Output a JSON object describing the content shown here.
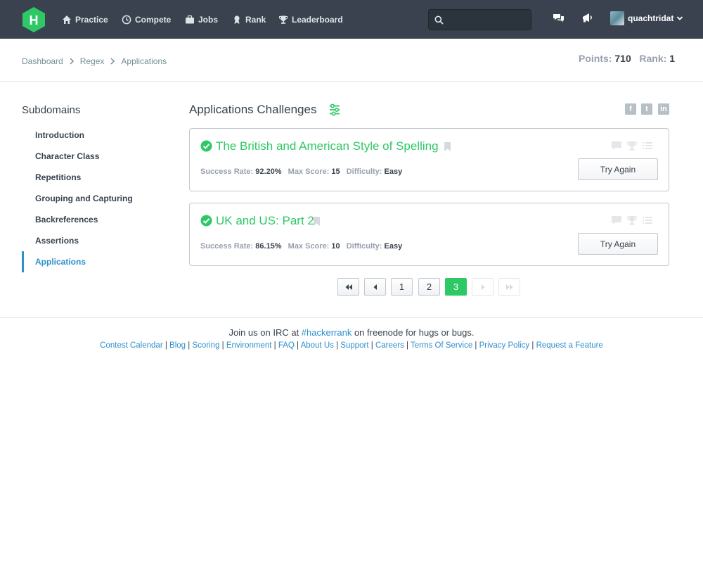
{
  "nav": {
    "items": [
      {
        "label": "Practice",
        "icon": "home-icon"
      },
      {
        "label": "Compete",
        "icon": "clock-icon"
      },
      {
        "label": "Jobs",
        "icon": "briefcase-icon"
      },
      {
        "label": "Rank",
        "icon": "medal-icon"
      },
      {
        "label": "Leaderboard",
        "icon": "trophy-icon"
      }
    ],
    "search_placeholder": "",
    "username": "quachtridat"
  },
  "breadcrumb": [
    "Dashboard",
    "Regex",
    "Applications"
  ],
  "stats": {
    "points_label": "Points:",
    "points_value": "710",
    "rank_label": "Rank:",
    "rank_value": "1"
  },
  "sidebar": {
    "title": "Subdomains",
    "items": [
      {
        "label": "Introduction"
      },
      {
        "label": "Character Class"
      },
      {
        "label": "Repetitions"
      },
      {
        "label": "Grouping and Capturing"
      },
      {
        "label": "Backreferences"
      },
      {
        "label": "Assertions"
      },
      {
        "label": "Applications",
        "active": true
      }
    ]
  },
  "main": {
    "title": "Applications Challenges",
    "challenges": [
      {
        "title": "The British and American Style of Spelling",
        "success_label": "Success Rate:",
        "success_value": "92.20%",
        "score_label": "Max Score:",
        "score_value": "15",
        "difficulty_label": "Difficulty:",
        "difficulty_value": "Easy",
        "button": "Try Again"
      },
      {
        "title": "UK and US: Part 2",
        "success_label": "Success Rate:",
        "success_value": "86.15%",
        "score_label": "Max Score:",
        "score_value": "10",
        "difficulty_label": "Difficulty:",
        "difficulty_value": "Easy",
        "button": "Try Again"
      }
    ]
  },
  "pagination": {
    "pages": [
      "1",
      "2",
      "3"
    ],
    "current": "3"
  },
  "footer": {
    "irc_prefix": "Join us on IRC at ",
    "irc_channel": "#hackerrank",
    "irc_suffix": " on freenode for hugs or bugs.",
    "links": [
      "Contest Calendar",
      "Blog",
      "Scoring",
      "Environment",
      "FAQ",
      "About Us",
      "Support",
      "Careers",
      "Terms Of Service",
      "Privacy Policy",
      "Request a Feature"
    ]
  },
  "colors": {
    "nav_bg": "#39424e",
    "accent_green": "#2ec866",
    "link_blue": "#2e8fcc"
  }
}
